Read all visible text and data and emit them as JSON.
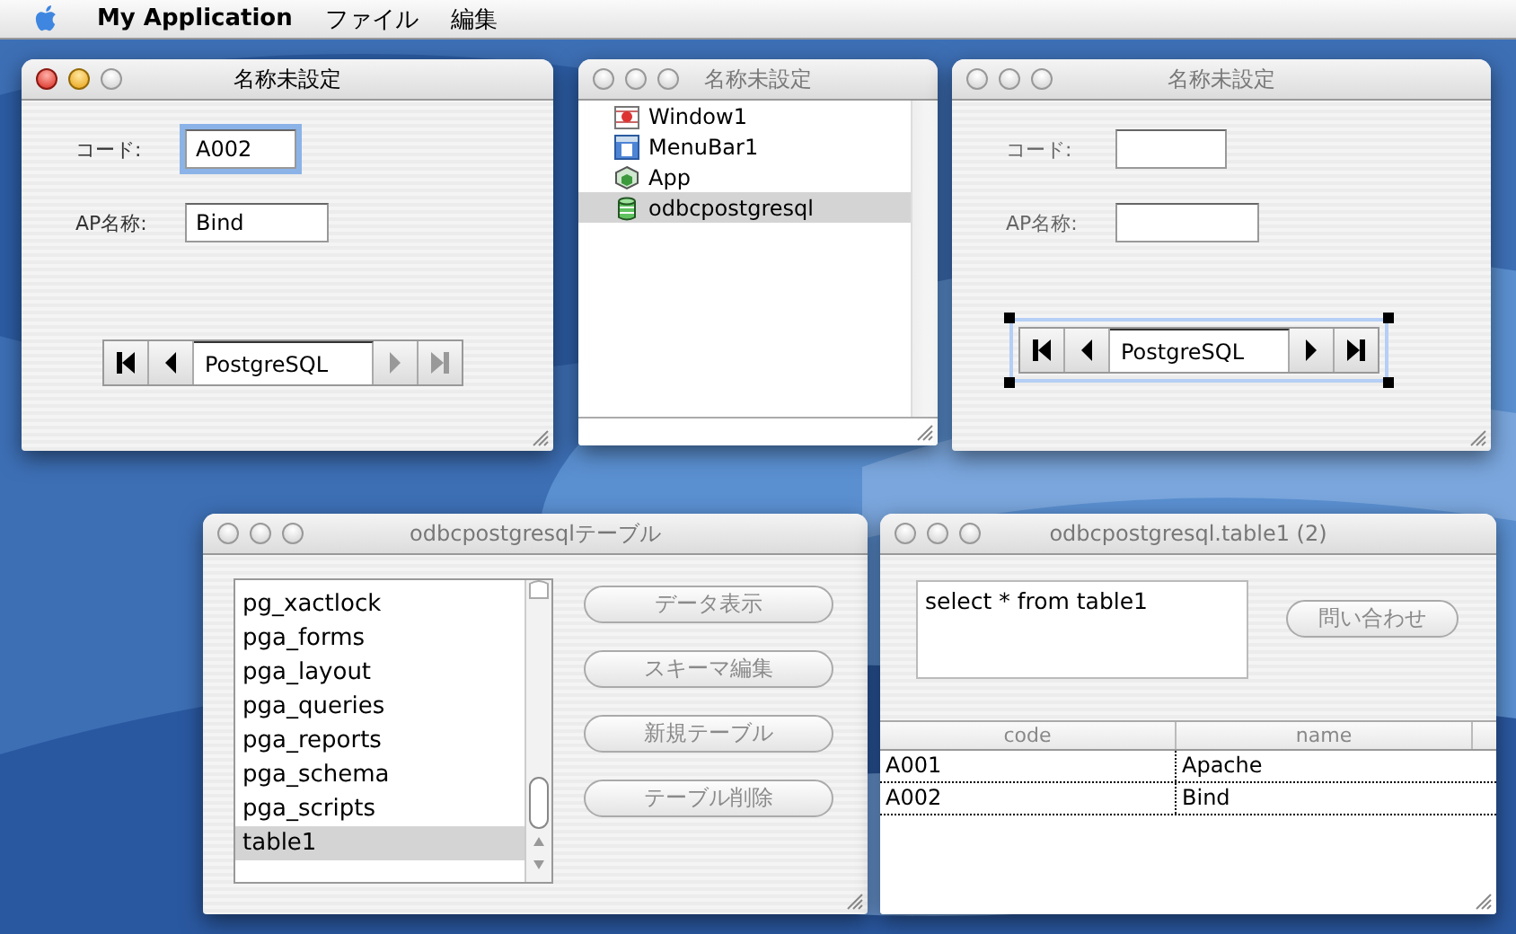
{
  "menu_bar": {
    "app_name": "My Application",
    "menus": [
      "ファイル",
      "編集"
    ]
  },
  "windows": [
    {
      "kind": "form",
      "title": "名称未設定",
      "active": true,
      "fields": [
        {
          "label": "コード:",
          "value": "A002",
          "focused": true
        },
        {
          "label": "AP名称:",
          "value": "Bind",
          "focused": false
        }
      ],
      "navigator": {
        "value": "PostgreSQL",
        "selected": false,
        "buttons": [
          {
            "kind": "first",
            "disabled": false
          },
          {
            "kind": "prev",
            "disabled": false
          },
          {
            "kind": "next",
            "disabled": true
          },
          {
            "kind": "last",
            "disabled": true
          }
        ]
      }
    },
    {
      "kind": "project",
      "title": "名称未設定",
      "active": false,
      "items": [
        {
          "kind": "window",
          "label": "Window1",
          "selected": false
        },
        {
          "kind": "menubar",
          "label": "MenuBar1",
          "selected": false
        },
        {
          "kind": "app",
          "label": "App",
          "selected": false
        },
        {
          "kind": "database",
          "label": "odbcpostgresql",
          "selected": true
        }
      ]
    },
    {
      "kind": "form",
      "title": "名称未設定",
      "active": false,
      "fields": [
        {
          "label": "コード:",
          "focused": false
        },
        {
          "label": "AP名称:",
          "focused": false
        }
      ],
      "navigator": {
        "value": "PostgreSQL",
        "selected": true,
        "buttons": [
          {
            "kind": "first",
            "disabled": false
          },
          {
            "kind": "prev",
            "disabled": false
          },
          {
            "kind": "next",
            "disabled": false
          },
          {
            "kind": "last",
            "disabled": false
          }
        ]
      }
    },
    {
      "kind": "tables",
      "title": "odbcpostgresqlテーブル",
      "active": false,
      "items": [
        {
          "label": "pg_xactlock",
          "selected": false
        },
        {
          "label": "pga_forms",
          "selected": false
        },
        {
          "label": "pga_layout",
          "selected": false
        },
        {
          "label": "pga_queries",
          "selected": false
        },
        {
          "label": "pga_reports",
          "selected": false
        },
        {
          "label": "pga_schema",
          "selected": false
        },
        {
          "label": "pga_scripts",
          "selected": false
        },
        {
          "label": "table1",
          "selected": true
        }
      ],
      "buttons": [
        "データ表示",
        "スキーマ編集",
        "新規テーブル",
        "テーブル削除"
      ]
    },
    {
      "kind": "query",
      "title": "odbcpostgresql.table1 (2)",
      "active": false,
      "query": "select * from table1",
      "button": "問い合わせ",
      "columns": [
        "code",
        "name"
      ],
      "rows": [
        [
          "A001",
          "Apache"
        ],
        [
          "A002",
          "Bind"
        ]
      ]
    }
  ]
}
